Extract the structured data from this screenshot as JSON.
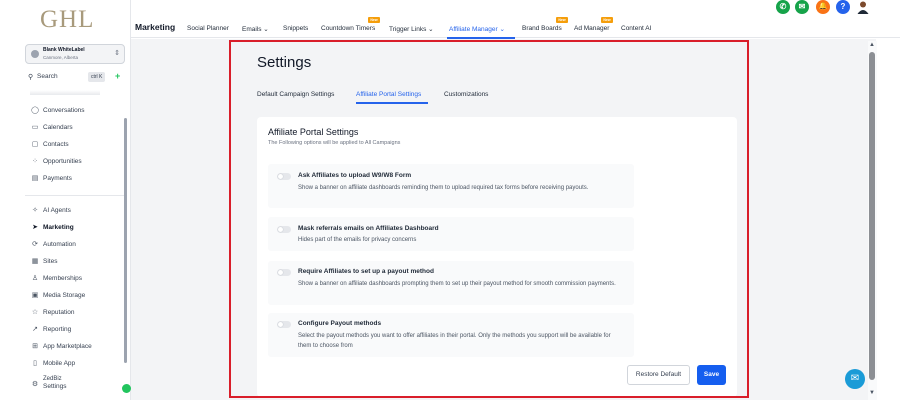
{
  "brand": {
    "logo_text": "GHL"
  },
  "account": {
    "name": "Blank WhiteLabel",
    "location": "Canmore, Alberta"
  },
  "search": {
    "label": "Search",
    "shortcut": "ctrl K"
  },
  "sidebar": {
    "items": [
      {
        "label": "Conversations"
      },
      {
        "label": "Calendars"
      },
      {
        "label": "Contacts"
      },
      {
        "label": "Opportunities"
      },
      {
        "label": "Payments"
      },
      {
        "label": "AI Agents"
      },
      {
        "label": "Marketing"
      },
      {
        "label": "Automation"
      },
      {
        "label": "Sites"
      },
      {
        "label": "Memberships"
      },
      {
        "label": "Media Storage"
      },
      {
        "label": "Reputation"
      },
      {
        "label": "Reporting"
      },
      {
        "label": "App Marketplace"
      },
      {
        "label": "Mobile App"
      },
      {
        "label": "ZedBiz"
      },
      {
        "label": "Settings"
      }
    ]
  },
  "topbar": {
    "title": "Marketing",
    "nav": [
      {
        "label": "Social Planner"
      },
      {
        "label": "Emails ⌄"
      },
      {
        "label": "Snippets"
      },
      {
        "label": "Countdown Timers"
      },
      {
        "label": "Trigger Links ⌄"
      },
      {
        "label": "Affiliate Manager ⌄"
      },
      {
        "label": "Brand Boards"
      },
      {
        "label": "Ad Manager"
      },
      {
        "label": "Content AI"
      }
    ],
    "new_badge": "New",
    "icons": {
      "phone": "✆",
      "megaphone": "✉",
      "bell": "🔔",
      "help": "?"
    }
  },
  "colors": {
    "accent": "#2563eb",
    "outline": "#d91e2a",
    "save": "#155eef"
  },
  "page": {
    "title": "Settings",
    "tabs": [
      {
        "label": "Default Campaign Settings"
      },
      {
        "label": "Affiliate Portal Settings"
      },
      {
        "label": "Customizations"
      }
    ]
  },
  "panel": {
    "title": "Affiliate Portal Settings",
    "subtitle": "The Following options will be applied to All Campaigns",
    "options": [
      {
        "title": "Ask Affiliates to upload W9/W8 Form",
        "desc": "Show a banner on affiliate dashboards reminding them to upload required tax forms before receiving payouts.",
        "enabled": false
      },
      {
        "title": "Mask referrals emails on Affiliates Dashboard",
        "desc": "Hides part of the emails for privacy concerns",
        "enabled": false
      },
      {
        "title": "Require Affiliates to set up a payout method",
        "desc": "Show a banner on affiliate dashboards prompting them to set up their payout method for smooth commission payments.",
        "enabled": false
      },
      {
        "title": "Configure Payout methods",
        "desc": "Select the payout methods you want to offer affiliates in their portal. Only the methods you support will be available for them to choose from",
        "enabled": false
      }
    ],
    "restore_label": "Restore Default",
    "save_label": "Save"
  }
}
